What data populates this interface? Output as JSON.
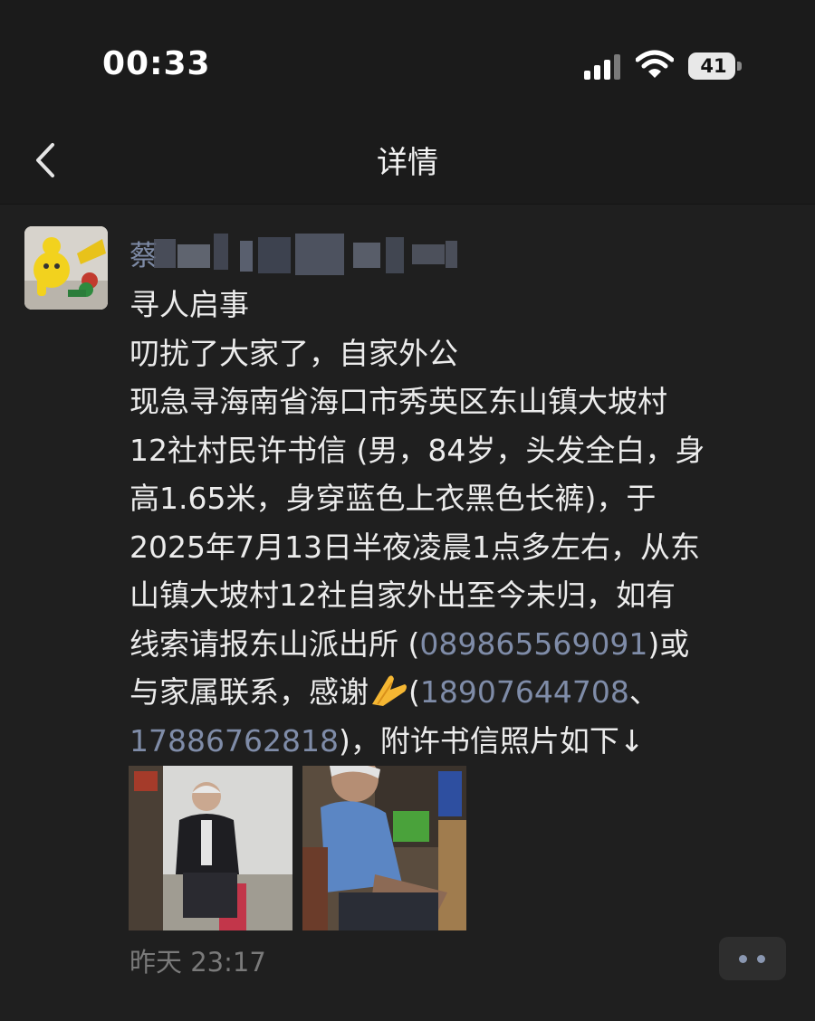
{
  "status_bar": {
    "time": "00:33",
    "battery_level": "41",
    "icons": [
      "cellular-signal-icon",
      "wifi-icon",
      "battery-icon"
    ]
  },
  "nav": {
    "back_icon": "chevron-left-icon",
    "title": "详情"
  },
  "post": {
    "author_prefix": "蔡",
    "lines": [
      [
        {
          "t": "寻人启事"
        }
      ],
      [
        {
          "t": "叨扰了大家了，自家外公"
        }
      ],
      [
        {
          "t": "现急寻海南省海口市秀英区东山镇大坡村"
        }
      ],
      [
        {
          "t": "12社村民许书信 (男，84岁，头发全白，身"
        }
      ],
      [
        {
          "t": "高1.65米，身穿蓝色上衣黑色长裤)，于"
        }
      ],
      [
        {
          "t": "2025年7月13日半夜凌晨1点多左右，从东"
        }
      ],
      [
        {
          "t": "山镇大坡村12社自家外出至今未归，如有"
        }
      ],
      [
        {
          "t": "线索请报东山派出所 ("
        },
        {
          "t": "089865569091",
          "link": true
        },
        {
          "t": ")或"
        }
      ],
      [
        {
          "t": "与家属联系，感谢"
        },
        {
          "emoji": "folded-hands-emoji"
        },
        {
          "t": "("
        },
        {
          "t": "18907644708",
          "link": true
        },
        {
          "t": "、"
        }
      ],
      [
        {
          "t": "17886762818",
          "link": true
        },
        {
          "t": ")，附许书信照片如下↓"
        }
      ]
    ],
    "photos": [
      "photo-elderly-man-seated-dark-jacket",
      "photo-elderly-man-blue-shirt"
    ],
    "timestamp": "昨天 23:17",
    "more_icon": "more-dots-icon"
  },
  "colors": {
    "background": "#1f1f1f",
    "text": "#ececec",
    "link": "#7f8ca8",
    "muted": "#7a7a7a"
  }
}
